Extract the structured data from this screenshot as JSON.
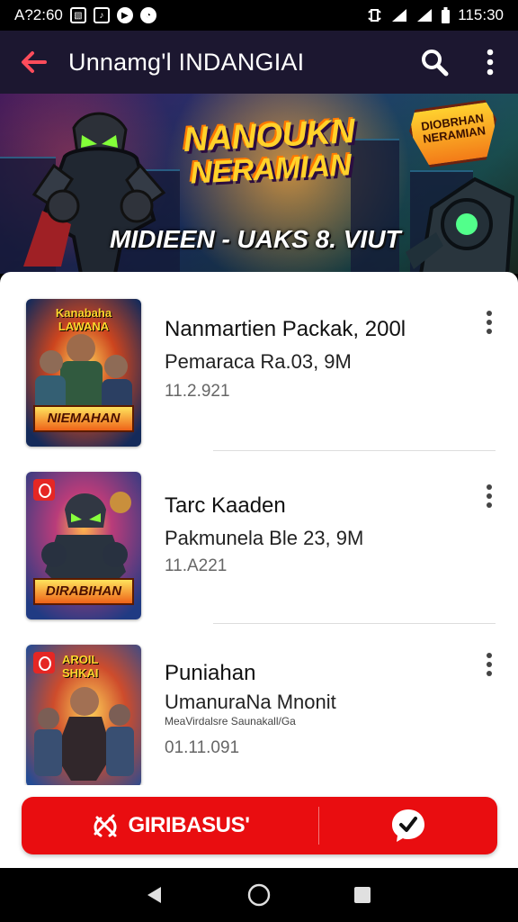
{
  "status_bar": {
    "time_left": "A?2:60",
    "time_right": "115:30",
    "icons": [
      "image-notification-icon",
      "music-notification-icon",
      "play-notification-icon",
      "chat-notification-icon",
      "vibrate-icon",
      "signal-icon",
      "signal-icon",
      "battery-icon"
    ]
  },
  "header": {
    "title": "Unnamg'l INDANGIAI",
    "back_icon": "back-arrow-icon",
    "search_icon": "search-icon",
    "more_icon": "more-vertical-icon"
  },
  "banner": {
    "title_line_1": "NANOUKN",
    "title_line_2": "NERAMIAN",
    "badge": "DIOBRHAN\nNERAMIAN",
    "subtitle": "MIDIEEN - UAKS 8. VIUT"
  },
  "items": [
    {
      "title": "Nanmartien Packak, 200l",
      "subtitle": "Pemaraca Ra.03, 9M",
      "extra": "",
      "date": "11.2.921",
      "thumb_top": "Kanabaha LAWANA",
      "thumb_label": "NIEMAHAN"
    },
    {
      "title": "Tarc Kaaden",
      "subtitle": "Pakmunela Ble 23, 9M",
      "extra": "",
      "date": "11.A221",
      "thumb_top": "",
      "thumb_label": "DIRABIHAN"
    },
    {
      "title": "Puniahan",
      "subtitle": "UmanuraNa Mnonit",
      "extra": "MeaVirdalsre Saunakall/Ga",
      "date": "01.11.091",
      "thumb_top": "AROIL SHKAI",
      "thumb_label": ""
    }
  ],
  "bottom_bar": {
    "main_action": "GIRIBASUS'",
    "main_icon": "game-controller-icon",
    "secondary_icon": "check-chat-icon"
  },
  "navigation": {
    "back": "back-nav-icon",
    "home": "home-nav-icon",
    "recent": "recent-apps-icon"
  },
  "colors": {
    "app_bar": "#1c1730",
    "accent": "#e90d10",
    "banner_yellow": "#ffd22b"
  }
}
